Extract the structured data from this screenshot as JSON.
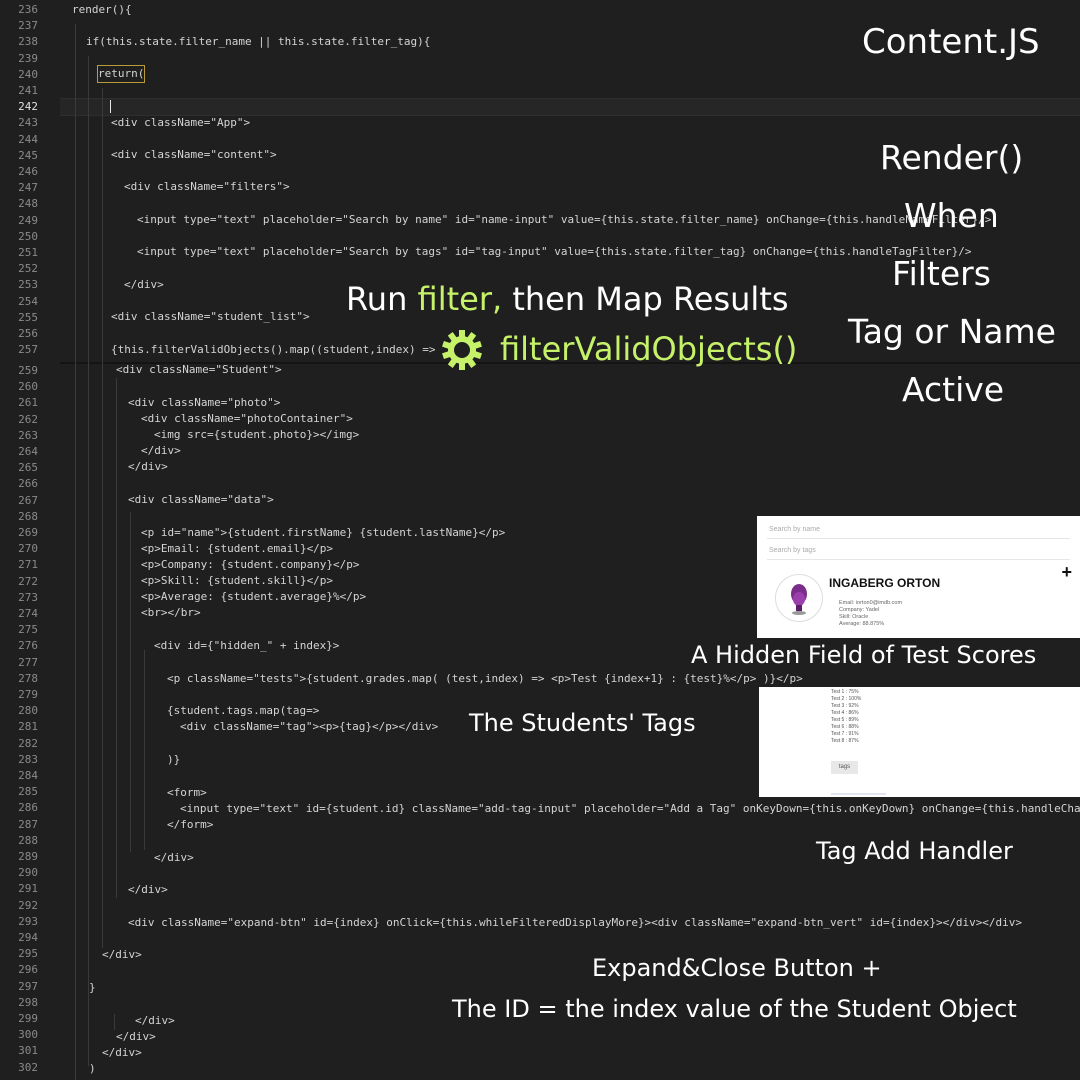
{
  "gutter_top": [
    "236",
    "237",
    "238",
    "239",
    "240",
    "241",
    "242",
    "243",
    "244",
    "245",
    "246",
    "247",
    "248",
    "249",
    "250",
    "251",
    "252",
    "253",
    "254",
    "255",
    "256",
    "257"
  ],
  "gutter_bottom": [
    "259",
    "260",
    "261",
    "262",
    "263",
    "264",
    "265",
    "266",
    "267",
    "268",
    "269",
    "270",
    "271",
    "272",
    "273",
    "274",
    "275",
    "276",
    "277",
    "278",
    "279",
    "280",
    "281",
    "282",
    "283",
    "284",
    "285",
    "286",
    "287",
    "288",
    "289",
    "290",
    "291",
    "292",
    "293",
    "294",
    "295",
    "296",
    "297",
    "298",
    "299",
    "300",
    "301",
    "302"
  ],
  "active_line": "242",
  "code": {
    "l236": "render(){",
    "l238": "if(this.state.filter_name || this.state.filter_tag){",
    "l240": "return(",
    "l243": "<div className=\"App\">",
    "l245": "<div className=\"content\">",
    "l247": "<div className=\"filters\">",
    "l249": "<input type=\"text\" placeholder=\"Search by name\" id=\"name-input\" value={this.state.filter_name} onChange={this.handleNameFilter}/>",
    "l251": "<input type=\"text\" placeholder=\"Search by tags\" id=\"tag-input\" value={this.state.filter_tag} onChange={this.handleTagFilter}/>",
    "l253": "</div>",
    "l255": "<div className=\"student_list\">",
    "l257": "{this.filterValidObjects().map((student,index) =>",
    "l259": "<div className=\"Student\">",
    "l261": "<div className=\"photo\">",
    "l262": "<div className=\"photoContainer\">",
    "l263": "<img src={student.photo}></img>",
    "l264": "</div>",
    "l265": "</div>",
    "l267": "<div className=\"data\">",
    "l269": "<p id=\"name\">{student.firstName} {student.lastName}</p>",
    "l270": "<p>Email: {student.email}</p>",
    "l271": "<p>Company: {student.company}</p>",
    "l272": "<p>Skill: {student.skill}</p>",
    "l273": "<p>Average: {student.average}%</p>",
    "l274": "<br></br>",
    "l276": "<div id={\"hidden_\" + index}>",
    "l278": "<p className=\"tests\">{student.grades.map( (test,index) => <p>Test {index+1} : {test}%</p> )}</p>",
    "l280": "{student.tags.map(tag=>",
    "l281": "<div className=\"tag\"><p>{tag}</p></div>",
    "l283": ")}",
    "l285": "<form>",
    "l286": "<input type=\"text\" id={student.id} className=\"add-tag-input\" placeholder=\"Add a Tag\" onKeyDown={this.onKeyDown} onChange={this.handleChan",
    "l287": "</form>",
    "l289": "</div>",
    "l291": "</div>",
    "l293": "<div className=\"expand-btn\" id={index} onClick={this.whileFilteredDisplayMore}><div className=\"expand-btn_vert\" id={index}></div></div>",
    "l295": "</div>",
    "l297": "}",
    "l299": "</div>",
    "l300": "</div>",
    "l301": "</div>",
    "l302": ")"
  },
  "annotations": {
    "title": "Content.JS",
    "render_lines": [
      "Render()",
      "When",
      "Filters",
      "Tag or Name",
      "Active"
    ],
    "run_filter_prefix": "Run",
    "run_filter_word": "filter,",
    "run_filter_suffix": "then Map Results",
    "filter_fn": "filterValidObjects()",
    "hidden_field": "A Hidden Field of Test Scores",
    "students_tags": "The Students' Tags",
    "tag_add_handler": "Tag Add Handler",
    "expand_line1": "Expand&Close Button +",
    "expand_line2": "The ID = the index value of the Student Object",
    "accent_color": "#c6f26a",
    "gear_icon": "gear-icon"
  },
  "preview_card": {
    "search_name_placeholder": "Search by name",
    "search_tags_placeholder": "Search by tags",
    "student_name": "INGABERG ORTON",
    "expand_symbol": "+",
    "email": "Email: iorton0@imdb.com",
    "company": "Company: Yadel",
    "skill": "Skill: Oracle",
    "average": "Average: 88.875%"
  },
  "preview_scores": {
    "tests": [
      "Test 1 : 75%",
      "Test 2 : 100%",
      "Test 3 : 92%",
      "Test 4 : 86%",
      "Test 5 : 89%",
      "Test 6 : 88%",
      "Test 7 : 91%",
      "Test 8 : 87%"
    ],
    "tag_chip": "tags"
  }
}
